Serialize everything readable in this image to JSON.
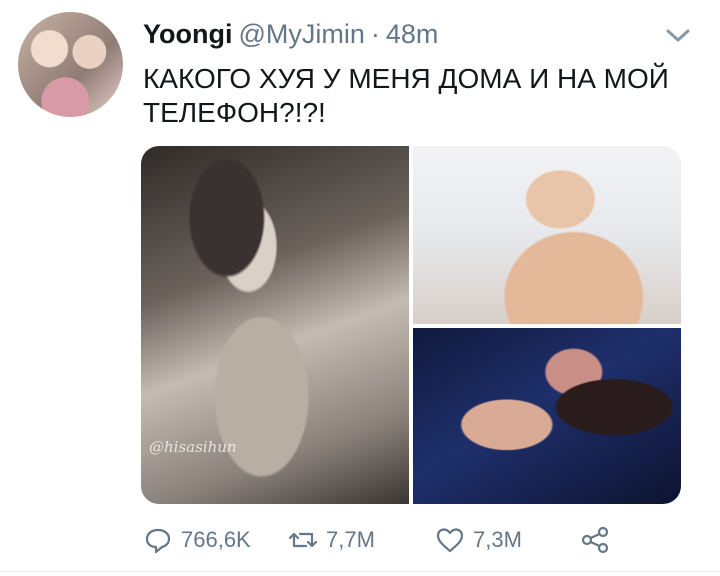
{
  "tweet": {
    "display_name": "Yoongi",
    "handle": "@MyJimin",
    "separator": "·",
    "time": "48m",
    "text": "КАКОГО ХУЯ У МЕНЯ ДОМА И НА МОЙ ТЕЛЕФОН?!?!",
    "media_watermark": "@hisasihun"
  },
  "actions": {
    "replies": "766,6K",
    "retweets": "7,7M",
    "likes": "7,3M"
  },
  "icons": {
    "reply": "reply-icon",
    "retweet": "retweet-icon",
    "like": "heart-icon",
    "share": "share-icon",
    "menu": "chevron-down-icon"
  },
  "colors": {
    "text": "#14171a",
    "secondary": "#657786",
    "divider": "#e6ecf0"
  }
}
